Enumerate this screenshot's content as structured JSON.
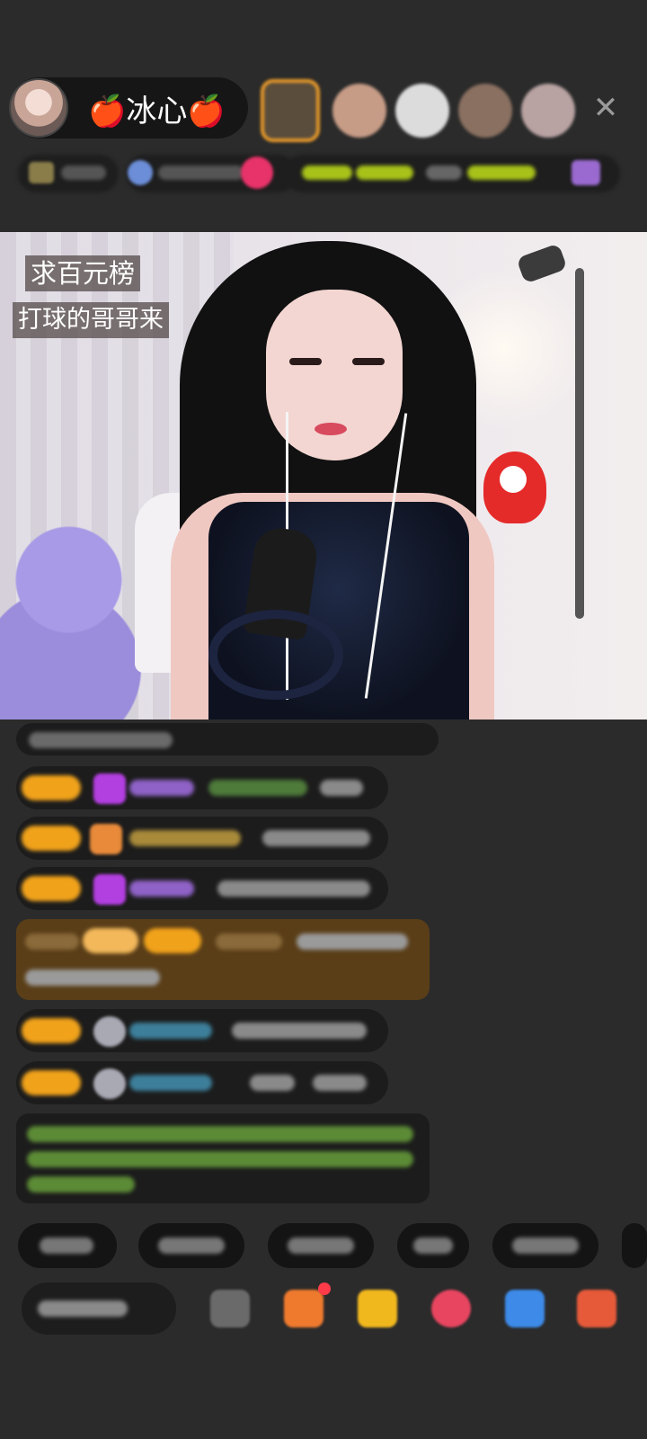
{
  "header": {
    "host_name": "🍎冰心🍎",
    "close_label": "✕"
  },
  "video": {
    "overlay_line_1": "求百元榜",
    "overlay_line_2": "打球的哥哥来"
  },
  "icons": {
    "close": "close-icon",
    "gift": "gift-icon",
    "more": "more-icon"
  },
  "colors": {
    "gold_badge": "#f0a21b",
    "gold_row": "#5a3e18",
    "green_text": "#7fb83a",
    "purple_gem": "#b23fe0",
    "accent_red": "#ff3b4a"
  }
}
